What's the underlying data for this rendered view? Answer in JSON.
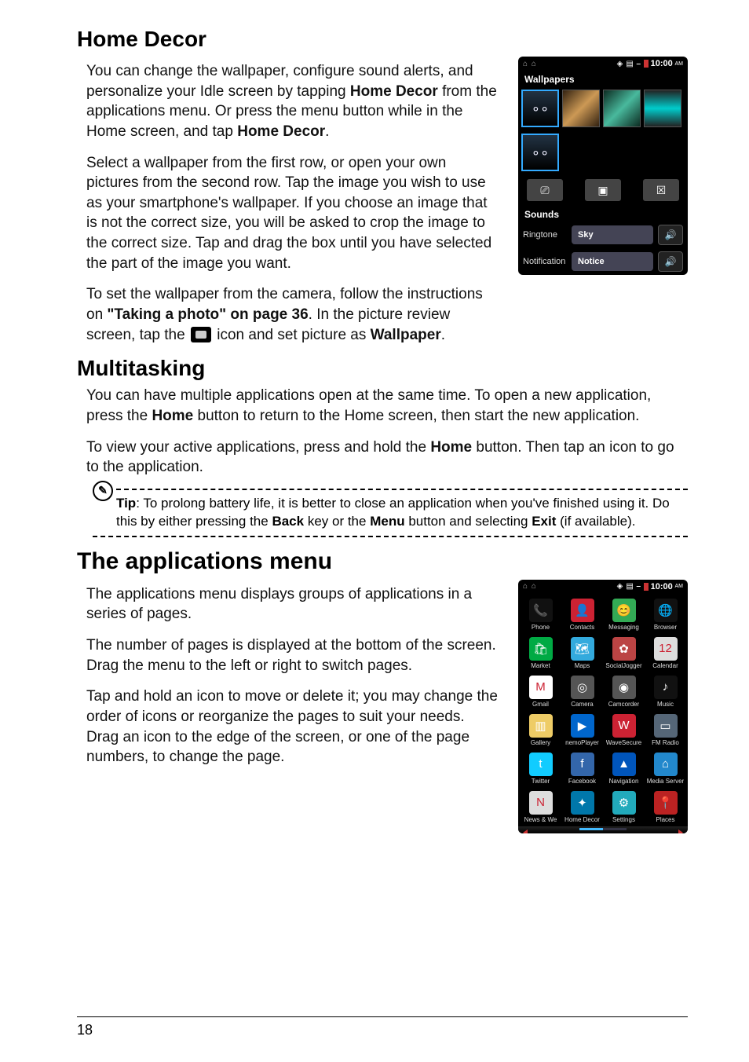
{
  "sections": {
    "homeDecor": {
      "title": "Home Decor",
      "p1a": "You can change the wallpaper, configure sound alerts, and personalize your Idle screen by tapping ",
      "p1b": "Home Decor",
      "p1c": " from the applications menu. Or press the menu button while in the Home screen, and tap ",
      "p1d": "Home Decor",
      "p1e": ".",
      "p2": "Select a wallpaper from the first row, or open your own pictures from the second row. Tap the image you wish to use as your smartphone's wallpaper. If you choose an image that is not the correct size, you will be asked to crop the image to the correct size. Tap and drag the box until you have selected the part of the image you want.",
      "p3a": "To set the wallpaper from the camera, follow the instructions on ",
      "p3b": "\"Taking a photo\" on page 36",
      "p3c": ". In the picture review screen, tap the ",
      "p3d": " icon and set picture as ",
      "p3e": "Wallpaper",
      "p3f": "."
    },
    "multitasking": {
      "title": "Multitasking",
      "p1a": "You can have multiple applications open at the same time. To open a new application, press the ",
      "p1b": "Home",
      "p1c": " button to return to the Home screen, then start the new application.",
      "p2a": "To view your active applications, press and hold the ",
      "p2b": "Home",
      "p2c": " button. Then tap an icon to go to the application.",
      "tipLabel": "Tip",
      "tipA": ": To prolong battery life, it is better to close an application when you've finished using it. Do this by either pressing the ",
      "tipB": "Back",
      "tipC": " key or the ",
      "tipD": "Menu",
      "tipE": " button and selecting ",
      "tipF": "Exit",
      "tipG": " (if available)."
    },
    "appsMenu": {
      "title": "The applications menu",
      "p1": "The applications menu displays groups of applications in a series of pages.",
      "p2": "The number of pages is displayed at the bottom of the screen. Drag the menu to the left or right to switch pages.",
      "p3": "Tap and hold an icon to move or delete it; you may change the order of icons or reorganize the pages to suit your needs. Drag an icon to the edge of the screen, or one of the page numbers, to change the page."
    }
  },
  "phone1": {
    "time": "10:00",
    "ampm": "AM",
    "wallpapers": "Wallpapers",
    "sounds": "Sounds",
    "ringtoneLabel": "Ringtone",
    "ringtoneValue": "Sky",
    "notifLabel": "Notification",
    "notifValue": "Notice"
  },
  "phone2": {
    "time": "10:00",
    "ampm": "AM",
    "apps": [
      {
        "label": "Phone",
        "glyph": "📞",
        "bg": "#111"
      },
      {
        "label": "Contacts",
        "glyph": "👤",
        "bg": "#c23"
      },
      {
        "label": "Messaging",
        "glyph": "😊",
        "bg": "#3a5"
      },
      {
        "label": "Browser",
        "glyph": "🌐",
        "bg": "#111"
      },
      {
        "label": "Market",
        "glyph": "🛍",
        "bg": "#0a4"
      },
      {
        "label": "Maps",
        "glyph": "🗺",
        "bg": "#3ad"
      },
      {
        "label": "SocialJogger",
        "glyph": "✿",
        "bg": "#b44"
      },
      {
        "label": "Calendar",
        "glyph": "12",
        "bg": "#ddd"
      },
      {
        "label": "Gmail",
        "glyph": "M",
        "bg": "#fff"
      },
      {
        "label": "Camera",
        "glyph": "◎",
        "bg": "#555"
      },
      {
        "label": "Camcorder",
        "glyph": "◉",
        "bg": "#555"
      },
      {
        "label": "Music",
        "glyph": "♪",
        "bg": "#111"
      },
      {
        "label": "Gallery",
        "glyph": "▥",
        "bg": "#ec6"
      },
      {
        "label": "nemoPlayer",
        "glyph": "▶",
        "bg": "#06c"
      },
      {
        "label": "WaveSecure",
        "glyph": "W",
        "bg": "#c23"
      },
      {
        "label": "FM Radio",
        "glyph": "▭",
        "bg": "#567"
      },
      {
        "label": "Twitter",
        "glyph": "t",
        "bg": "#1cf"
      },
      {
        "label": "Facebook",
        "glyph": "f",
        "bg": "#36a"
      },
      {
        "label": "Navigation",
        "glyph": "▲",
        "bg": "#05b"
      },
      {
        "label": "Media Server",
        "glyph": "⌂",
        "bg": "#28c"
      },
      {
        "label": "News & We",
        "glyph": "N",
        "bg": "#ddd"
      },
      {
        "label": "Home Decor",
        "glyph": "✦",
        "bg": "#07a"
      },
      {
        "label": "Settings",
        "glyph": "⚙",
        "bg": "#2ab"
      },
      {
        "label": "Places",
        "glyph": "📍",
        "bg": "#b22"
      }
    ]
  },
  "pageNumber": "18"
}
